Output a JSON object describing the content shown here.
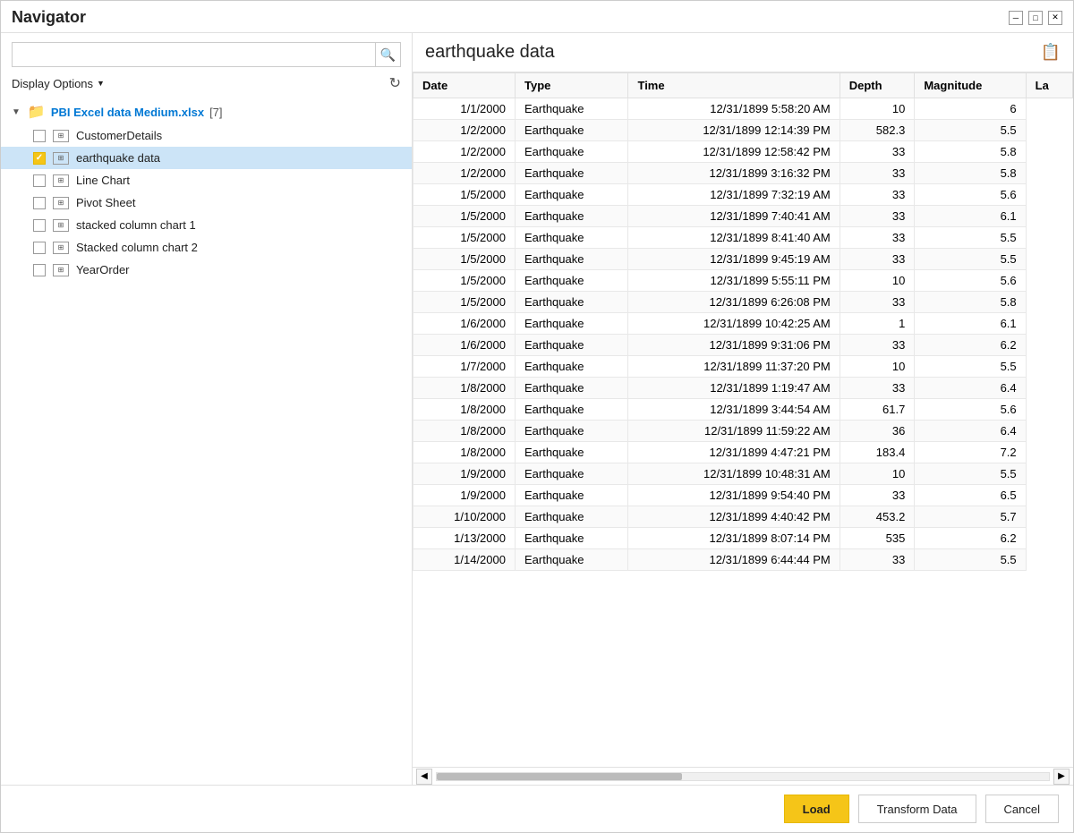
{
  "window": {
    "title": "Navigator"
  },
  "left_panel": {
    "search_placeholder": "",
    "display_options_label": "Display Options",
    "chevron": "▼",
    "file": {
      "name": "PBI Excel data Medium.xlsx",
      "count": "[7]",
      "items": [
        {
          "id": "customer-details",
          "label": "CustomerDetails",
          "checked": false,
          "selected": false
        },
        {
          "id": "earthquake-data",
          "label": "earthquake data",
          "checked": true,
          "selected": true
        },
        {
          "id": "line-chart",
          "label": "Line Chart",
          "checked": false,
          "selected": false
        },
        {
          "id": "pivot-sheet",
          "label": "Pivot Sheet",
          "checked": false,
          "selected": false
        },
        {
          "id": "stacked-col-1",
          "label": "stacked column chart 1",
          "checked": false,
          "selected": false
        },
        {
          "id": "stacked-col-2",
          "label": "Stacked column chart 2",
          "checked": false,
          "selected": false
        },
        {
          "id": "year-order",
          "label": "YearOrder",
          "checked": false,
          "selected": false
        }
      ]
    }
  },
  "right_panel": {
    "title": "earthquake data",
    "columns": [
      "Date",
      "Type",
      "Time",
      "Depth",
      "Magnitude",
      "La"
    ],
    "rows": [
      [
        "1/1/2000",
        "Earthquake",
        "12/31/1899 5:58:20 AM",
        "10",
        "6"
      ],
      [
        "1/2/2000",
        "Earthquake",
        "12/31/1899 12:14:39 PM",
        "582.3",
        "5.5"
      ],
      [
        "1/2/2000",
        "Earthquake",
        "12/31/1899 12:58:42 PM",
        "33",
        "5.8"
      ],
      [
        "1/2/2000",
        "Earthquake",
        "12/31/1899 3:16:32 PM",
        "33",
        "5.8"
      ],
      [
        "1/5/2000",
        "Earthquake",
        "12/31/1899 7:32:19 AM",
        "33",
        "5.6"
      ],
      [
        "1/5/2000",
        "Earthquake",
        "12/31/1899 7:40:41 AM",
        "33",
        "6.1"
      ],
      [
        "1/5/2000",
        "Earthquake",
        "12/31/1899 8:41:40 AM",
        "33",
        "5.5"
      ],
      [
        "1/5/2000",
        "Earthquake",
        "12/31/1899 9:45:19 AM",
        "33",
        "5.5"
      ],
      [
        "1/5/2000",
        "Earthquake",
        "12/31/1899 5:55:11 PM",
        "10",
        "5.6"
      ],
      [
        "1/5/2000",
        "Earthquake",
        "12/31/1899 6:26:08 PM",
        "33",
        "5.8"
      ],
      [
        "1/6/2000",
        "Earthquake",
        "12/31/1899 10:42:25 AM",
        "1",
        "6.1"
      ],
      [
        "1/6/2000",
        "Earthquake",
        "12/31/1899 9:31:06 PM",
        "33",
        "6.2"
      ],
      [
        "1/7/2000",
        "Earthquake",
        "12/31/1899 11:37:20 PM",
        "10",
        "5.5"
      ],
      [
        "1/8/2000",
        "Earthquake",
        "12/31/1899 1:19:47 AM",
        "33",
        "6.4"
      ],
      [
        "1/8/2000",
        "Earthquake",
        "12/31/1899 3:44:54 AM",
        "61.7",
        "5.6"
      ],
      [
        "1/8/2000",
        "Earthquake",
        "12/31/1899 11:59:22 AM",
        "36",
        "6.4"
      ],
      [
        "1/8/2000",
        "Earthquake",
        "12/31/1899 4:47:21 PM",
        "183.4",
        "7.2"
      ],
      [
        "1/9/2000",
        "Earthquake",
        "12/31/1899 10:48:31 AM",
        "10",
        "5.5"
      ],
      [
        "1/9/2000",
        "Earthquake",
        "12/31/1899 9:54:40 PM",
        "33",
        "6.5"
      ],
      [
        "1/10/2000",
        "Earthquake",
        "12/31/1899 4:40:42 PM",
        "453.2",
        "5.7"
      ],
      [
        "1/13/2000",
        "Earthquake",
        "12/31/1899 8:07:14 PM",
        "535",
        "6.2"
      ],
      [
        "1/14/2000",
        "Earthquake",
        "12/31/1899 6:44:44 PM",
        "33",
        "5.5"
      ]
    ]
  },
  "footer": {
    "load_label": "Load",
    "transform_label": "Transform Data",
    "cancel_label": "Cancel"
  },
  "icons": {
    "search": "🔍",
    "refresh": "↻",
    "minimize": "─",
    "restore": "□",
    "close": "✕",
    "arrow_down": "▼",
    "arrow_right": "▶",
    "arrow_left": "◀",
    "chevron_up": "▲",
    "chevron_down": "▼",
    "preview_file": "📋"
  }
}
